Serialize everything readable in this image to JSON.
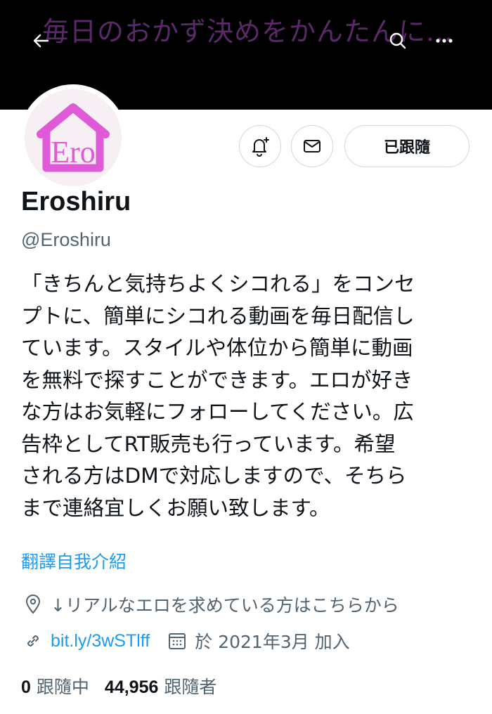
{
  "header": {
    "banner_text": "毎日のおかず決めをかんたんに..."
  },
  "profile": {
    "avatar_text": "Ero",
    "display_name": "Eroshiru",
    "handle": "@Eroshiru",
    "follow_button_label": "已跟隨",
    "bio_lines": [
      "「きちんと気持ちよくシコれる」をコンセ",
      "プトに、簡単にシコれる動画を毎日配信し",
      "ています。スタイルや体位から簡単に動画",
      "を無料で探すことができます。エロが好き",
      "な方はお気軽にフォローしてください。広",
      "告枠としてRT販売も行っています。希望",
      "される方はDMで対応しますので、そちら",
      "まで連絡宜しくお願い致します。"
    ],
    "translate_label": "翻譯自我介紹",
    "location": "↓リアルなエロを求めている方はこちらから",
    "link": "bit.ly/3wSTlff",
    "joined": "於 2021年3月 加入",
    "following_count": "0",
    "following_label": "跟隨中",
    "followers_count": "44,956",
    "followers_label": "跟隨者"
  },
  "colors": {
    "link_blue": "#1d9bf0",
    "secondary_text": "#536471",
    "avatar_pink": "#e05ad8",
    "banner_text": "#5a2a68"
  },
  "icons": {
    "back": "arrow-left-icon",
    "search": "search-icon",
    "more": "more-icon",
    "notify": "bell-plus-icon",
    "dm": "envelope-icon",
    "location": "location-pin-icon",
    "link": "link-icon",
    "calendar": "calendar-icon"
  }
}
